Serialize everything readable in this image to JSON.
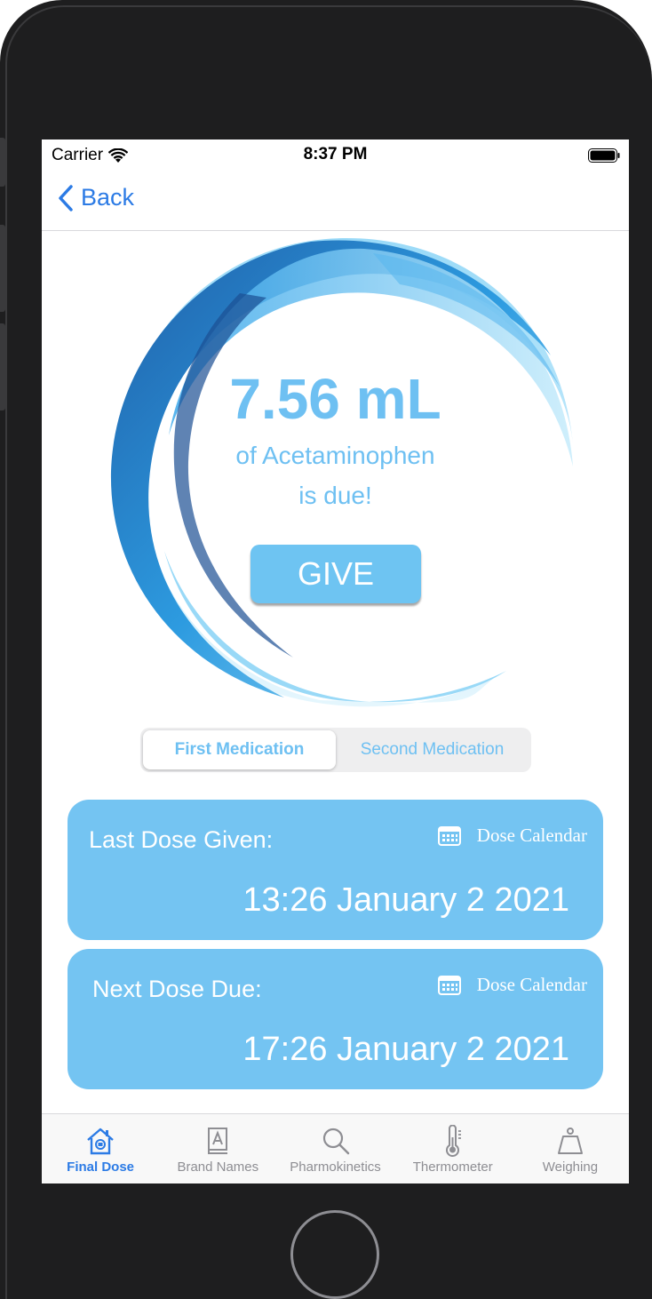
{
  "status_bar": {
    "carrier": "Carrier",
    "time": "8:37 PM"
  },
  "nav": {
    "back_label": "Back"
  },
  "hero": {
    "dose_amount": "7.56 mL",
    "line1": "of Acetaminophen",
    "line2": "is due!",
    "give_label": "GIVE"
  },
  "segments": [
    {
      "label": "First Medication",
      "selected": true
    },
    {
      "label": "Second Medication",
      "selected": false
    }
  ],
  "cards": [
    {
      "title": "Last Dose Given:",
      "link": "Dose Calendar",
      "time": "13:26 January 2 2021"
    },
    {
      "title": "Next Dose Due:",
      "link": "Dose Calendar",
      "time": "17:26 January 2 2021"
    }
  ],
  "tabs": [
    {
      "label": "Final Dose",
      "icon": "home-icon",
      "active": true
    },
    {
      "label": "Brand Names",
      "icon": "book-icon",
      "active": false
    },
    {
      "label": "Pharmokinetics",
      "icon": "search-icon",
      "active": false
    },
    {
      "label": "Thermometer",
      "icon": "thermometer-icon",
      "active": false
    },
    {
      "label": "Weighing",
      "icon": "scale-icon",
      "active": false
    }
  ],
  "colors": {
    "accent": "#6ec0f2",
    "card": "#74c4f2",
    "link": "#2c7be5"
  }
}
